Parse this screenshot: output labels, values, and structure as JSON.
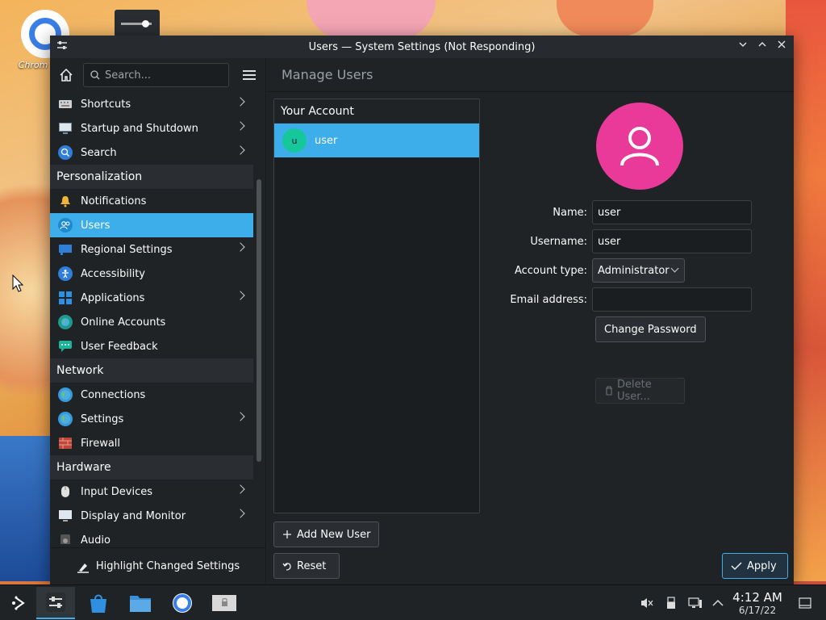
{
  "desktop": {
    "icon_label": "Chrom"
  },
  "window": {
    "title": "Users — System Settings (Not Responding)",
    "controls": [
      "minimize",
      "maximize",
      "close"
    ]
  },
  "sidebar": {
    "search_placeholder": "Search...",
    "items": [
      {
        "label": "Shortcuts",
        "icon": "keyboard-icon",
        "chevron": true
      },
      {
        "label": "Startup and Shutdown",
        "icon": "monitor-power-icon",
        "chevron": true
      },
      {
        "label": "Search",
        "icon": "search-icon",
        "chevron": true
      }
    ],
    "categories": {
      "personalization": {
        "title": "Personalization",
        "items": [
          {
            "label": "Notifications",
            "icon": "bell-icon",
            "chevron": false
          },
          {
            "label": "Users",
            "icon": "users-icon",
            "chevron": false,
            "active": true
          },
          {
            "label": "Regional Settings",
            "icon": "flag-icon",
            "chevron": true
          },
          {
            "label": "Accessibility",
            "icon": "accessibility-icon",
            "chevron": false
          },
          {
            "label": "Applications",
            "icon": "apps-icon",
            "chevron": true
          },
          {
            "label": "Online Accounts",
            "icon": "globe-icon",
            "chevron": false
          },
          {
            "label": "User Feedback",
            "icon": "feedback-icon",
            "chevron": false
          }
        ]
      },
      "network": {
        "title": "Network",
        "items": [
          {
            "label": "Connections",
            "icon": "globe-icon",
            "chevron": false
          },
          {
            "label": "Settings",
            "icon": "globe-settings-icon",
            "chevron": true
          },
          {
            "label": "Firewall",
            "icon": "firewall-icon",
            "chevron": false
          }
        ]
      },
      "hardware": {
        "title": "Hardware",
        "items": [
          {
            "label": "Input Devices",
            "icon": "mouse-icon",
            "chevron": true
          },
          {
            "label": "Display and Monitor",
            "icon": "display-icon",
            "chevron": true
          },
          {
            "label": "Audio",
            "icon": "speaker-icon",
            "chevron": false
          }
        ]
      }
    },
    "footer_label": "Highlight Changed Settings"
  },
  "content": {
    "title": "Manage Users",
    "list_header": "Your Account",
    "user_row": {
      "initial": "u",
      "name": "user"
    },
    "add_user_label": "Add New User",
    "reset_label": "Reset",
    "apply_label": "Apply",
    "form": {
      "name_label": "Name:",
      "name_value": "user",
      "username_label": "Username:",
      "username_value": "user",
      "account_type_label": "Account type:",
      "account_type_value": "Administrator",
      "email_label": "Email address:",
      "email_value": "",
      "change_password_label": "Change Password",
      "delete_user_label": "Delete User..."
    },
    "avatar_color": "#e93a9a"
  },
  "taskbar": {
    "time": "4:12 AM",
    "date": "6/17/22",
    "apps": [
      "app-launcher-icon",
      "system-settings-icon",
      "discover-store-icon",
      "dolphin-files-icon",
      "chromium-icon",
      "locked-app-icon"
    ],
    "tray": [
      "volume-muted-icon",
      "usb-icon",
      "network-icon",
      "tray-expand-icon",
      "show-desktop-icon"
    ]
  },
  "colors": {
    "accent": "#3daee9",
    "window_bg": "#202326",
    "user_avatar": "#16c79b"
  }
}
